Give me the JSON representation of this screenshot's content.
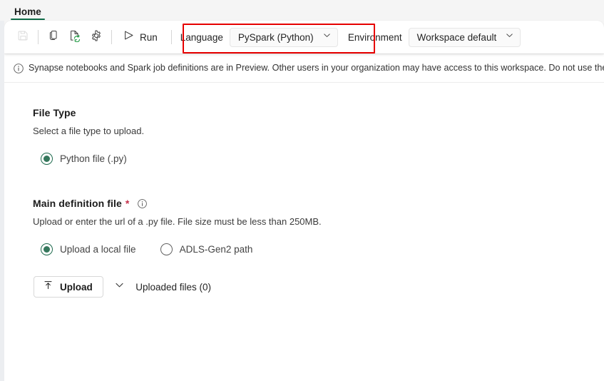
{
  "window": {
    "accent_green": "#0f6b47",
    "highlight_color": "#e60000",
    "required_color": "#c4314b"
  },
  "ribbon": {
    "tabs": [
      {
        "label": "Home",
        "active": true
      }
    ]
  },
  "toolbar": {
    "buttons": [
      {
        "name": "save-icon",
        "label": "Save",
        "disabled": true
      },
      {
        "name": "copy-icon",
        "label": "Copy",
        "disabled": false
      },
      {
        "name": "publish-refresh-icon",
        "label": "Publish",
        "disabled": false
      },
      {
        "name": "settings-gear-icon",
        "label": "Settings",
        "disabled": false
      }
    ],
    "run_label": "Run",
    "language": {
      "label": "Language",
      "value": "PySpark (Python)"
    },
    "environment": {
      "label": "Environment",
      "value": "Workspace default"
    }
  },
  "banner": {
    "icon": "info-circle-icon",
    "text": "Synapse notebooks and Spark job definitions are in Preview. Other users in your organization may have access to this workspace. Do not use these items"
  },
  "main": {
    "file_type": {
      "title": "File Type",
      "description": "Select a file type to upload.",
      "options": [
        {
          "label": "Python file (.py)",
          "checked": true
        }
      ]
    },
    "main_definition_file": {
      "title": "Main definition file",
      "required_mark": "*",
      "info_icon": "info-circle-icon",
      "description": "Upload or enter the url of a .py file. File size must be less than 250MB.",
      "options": [
        {
          "label": "Upload a local file",
          "checked": true
        },
        {
          "label": "ADLS-Gen2 path",
          "checked": false
        }
      ],
      "upload_button": {
        "icon": "upload-arrow-icon",
        "label": "Upload"
      },
      "uploaded_files": {
        "icon": "chevron-down-icon",
        "label": "Uploaded files (0)"
      }
    }
  }
}
